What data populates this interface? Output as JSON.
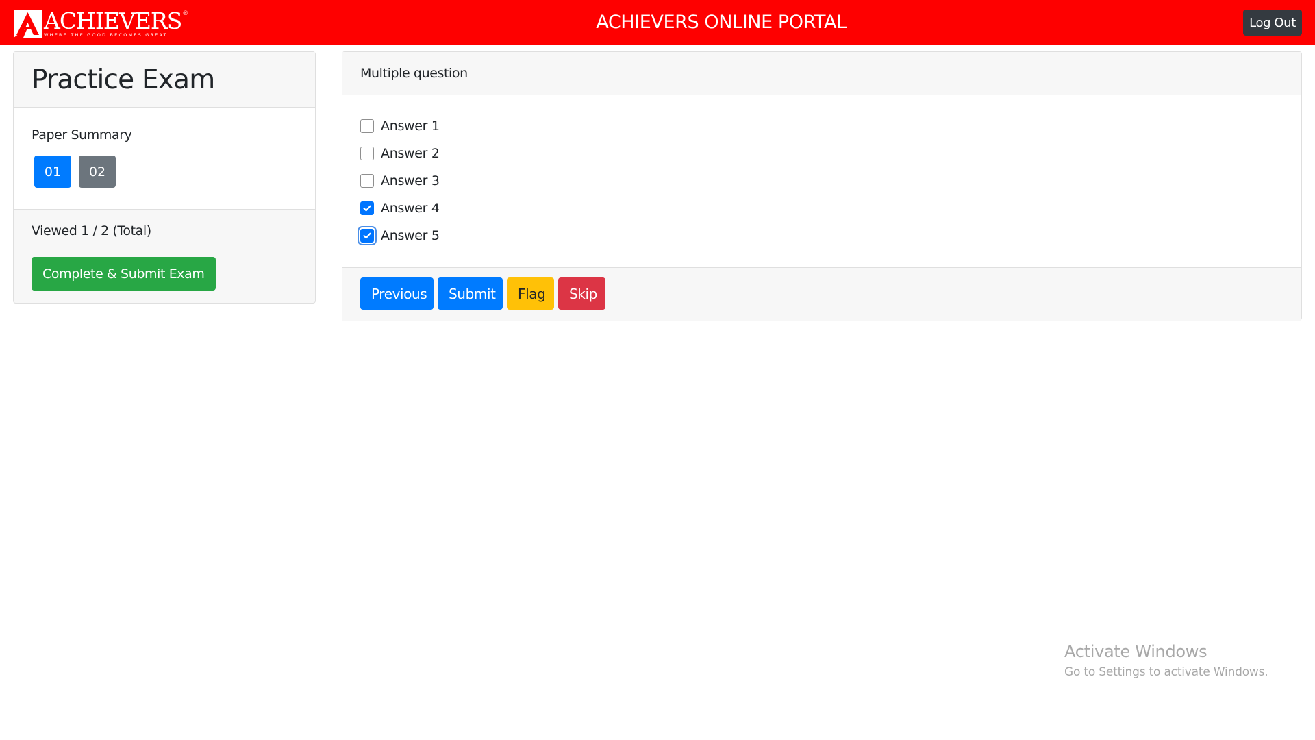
{
  "header": {
    "brand": "ACHIEVERS",
    "brand_reg": "®",
    "tagline": "WHERE THE GOOD BECOMES GREAT",
    "portal_title": "ACHIEVERS ONLINE PORTAL",
    "logout_label": "Log Out"
  },
  "sidebar": {
    "title": "Practice Exam",
    "summary_label": "Paper Summary",
    "questions": [
      {
        "label": "01",
        "state": "active"
      },
      {
        "label": "02",
        "state": "inactive"
      }
    ],
    "viewed_text": "Viewed 1 / 2 (Total)",
    "complete_button": "Complete & Submit Exam"
  },
  "question": {
    "title": "Multiple question",
    "options": [
      {
        "label": "Answer 1",
        "checked": false
      },
      {
        "label": "Answer 2",
        "checked": false
      },
      {
        "label": "Answer 3",
        "checked": false
      },
      {
        "label": "Answer 4",
        "checked": true
      },
      {
        "label": "Answer 5",
        "checked": true
      }
    ],
    "actions": {
      "previous": "Previous",
      "submit": "Submit",
      "flag": "Flag",
      "skip": "Skip"
    }
  },
  "watermark": {
    "title": "Activate Windows",
    "subtitle": "Go to Settings to activate Windows."
  },
  "colors": {
    "topbar": "#fe0000",
    "primary": "#007bff",
    "secondary": "#6c757d",
    "success": "#28a745",
    "warning": "#ffc107",
    "danger": "#dc3545",
    "dark": "#343a40"
  }
}
